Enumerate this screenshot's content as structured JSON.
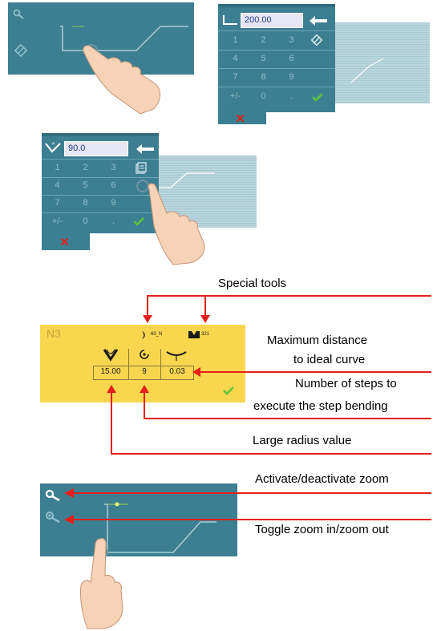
{
  "screen1": {},
  "screen2": {
    "input_value": "200.00",
    "keys": [
      "1",
      "2",
      "3",
      "4",
      "5",
      "6",
      "7",
      "8",
      "9",
      "+/-",
      "0",
      "."
    ]
  },
  "screen3": {
    "input_value": "90.0",
    "keys": [
      "1",
      "2",
      "3",
      "4",
      "5",
      "6",
      "7",
      "8",
      "9",
      "+/-",
      "0",
      "."
    ]
  },
  "tool_panel": {
    "label": "N3",
    "tool1_label": "60_N",
    "tool2_label": "321",
    "values": [
      "15.00",
      "9",
      "0.03"
    ]
  },
  "annotations": {
    "special_tools": "Special tools",
    "max_distance_line1": "Maximum distance",
    "max_distance_line2": "to ideal curve",
    "steps_line1": "Number of steps to",
    "steps_line2": "execute the step bending",
    "large_radius": "Large radius value",
    "activate_zoom": "Activate/deactivate zoom",
    "toggle_zoom": "Toggle zoom in/zoom out"
  },
  "colors": {
    "panel": "#3d7f92",
    "key_text": "#8fc0cc",
    "accent_red": "#e3201b",
    "check_green": "#5cc43c",
    "tool_bg": "#f8d64e"
  }
}
